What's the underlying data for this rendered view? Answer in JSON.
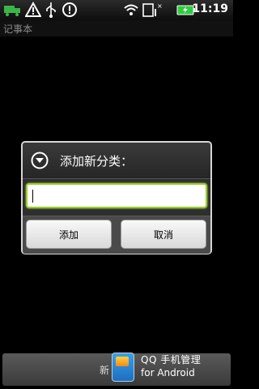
{
  "status_bar": {
    "time": "11:19",
    "icons": [
      "truck-icon",
      "warning-icon",
      "usb-icon",
      "alert-icon",
      "wifi-icon",
      "sim-icon",
      "battery-icon"
    ]
  },
  "app": {
    "title": "记事本"
  },
  "dialog": {
    "title": "添加新分类：",
    "input_value": "",
    "confirm_label": "添加",
    "cancel_label": "取消"
  },
  "bottom": {
    "button_text": "新",
    "qq_line1": "QQ 手机管理",
    "qq_line2": "for Android"
  },
  "colors": {
    "input_focus": "#9bcc2c",
    "dialog_border": "#d6d6d6",
    "background": "#000000"
  }
}
